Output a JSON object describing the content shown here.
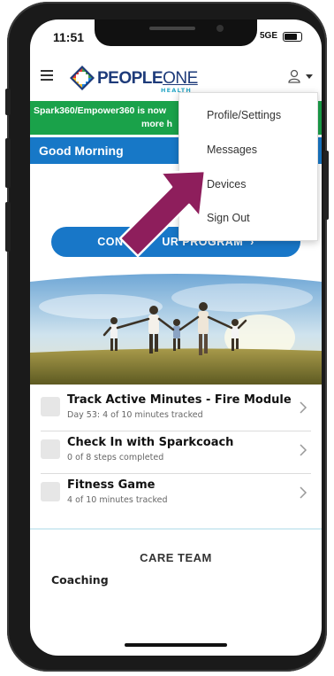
{
  "status_bar": {
    "time": "11:51",
    "network": "5GE"
  },
  "header": {
    "brand": "PEOPLE",
    "brand_suffix": "ONE",
    "brand_sub": "HEALTH"
  },
  "banner": {
    "line1": "Spark360/Empower360 is now",
    "line2": "more h",
    "color": "#1aa24a"
  },
  "greeting": {
    "text": "Good Morning",
    "color": "#1778c7"
  },
  "cta": {
    "label": "CONTI        UR PROGRAM  ›"
  },
  "menu": {
    "items": [
      {
        "label": "Profile/Settings"
      },
      {
        "label": "Messages"
      },
      {
        "label": "Devices"
      },
      {
        "label": "Sign Out"
      }
    ]
  },
  "tasks": [
    {
      "title": "Track Active Minutes - Fire Module",
      "subtitle": "Day 53: 4 of 10 minutes tracked"
    },
    {
      "title": "Check In with Sparkcoach",
      "subtitle": "0 of 8 steps completed"
    },
    {
      "title": "Fitness Game",
      "subtitle": "4 of 10 minutes tracked"
    }
  ],
  "care_team": {
    "heading": "CARE TEAM",
    "item": "Coaching"
  },
  "colors": {
    "accent_blue": "#1778c7",
    "green": "#1aa24a",
    "arrow": "#8e1e5c",
    "logo_navy": "#1e3b7a"
  },
  "icons": [
    "menu-icon",
    "user-icon",
    "chevron-right-icon",
    "battery-icon",
    "arrow-pointer-icon"
  ]
}
